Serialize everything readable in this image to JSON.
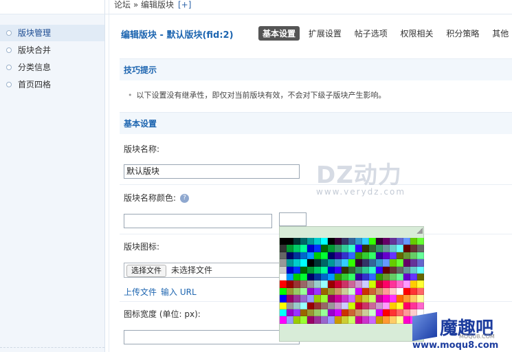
{
  "sidebar": {
    "items": [
      {
        "label": "版块管理",
        "active": true
      },
      {
        "label": "版块合并",
        "active": false
      },
      {
        "label": "分类信息",
        "active": false
      },
      {
        "label": "首页四格",
        "active": false
      }
    ]
  },
  "breadcrumb": {
    "text": "论坛 » 编辑版块",
    "plus": "[+]"
  },
  "header": {
    "title": "编辑版块 - 默认版块(fid:2)",
    "tabs": [
      "基本设置",
      "扩展设置",
      "帖子选项",
      "权限相关",
      "积分策略",
      "其他"
    ]
  },
  "tips": {
    "heading": "技巧提示",
    "text": "以下设置没有继承性，即仅对当前版块有效，不会对下级子版块产生影响。"
  },
  "basic": {
    "heading": "基本设置",
    "name_label": "版块名称:",
    "name_value": "默认版块",
    "color_label": "版块名称颜色:",
    "help_icon": "?",
    "color_value": "",
    "icon_label": "版块图标:",
    "file_button": "选择文件",
    "file_status": "未选择文件",
    "upload_link": "上传文件",
    "url_link": "输入 URL",
    "width_label": "图标宽度 (单位: px):",
    "width_value": ""
  },
  "watermark": {
    "brand": "DZ动力",
    "url": "www.verydz.com"
  },
  "logo": {
    "text": "魔趣吧",
    "sub": "MOQU8.COM",
    "url": "www.moqu8.com"
  },
  "palette": {
    "colors": [
      "#000000",
      "#333333",
      "#666666",
      "#999999",
      "#cccccc",
      "#ffffff",
      "#ff0000",
      "#00ff00",
      "#0000ff",
      "#ffff00",
      "#00ffff",
      "#ff00ff"
    ]
  }
}
